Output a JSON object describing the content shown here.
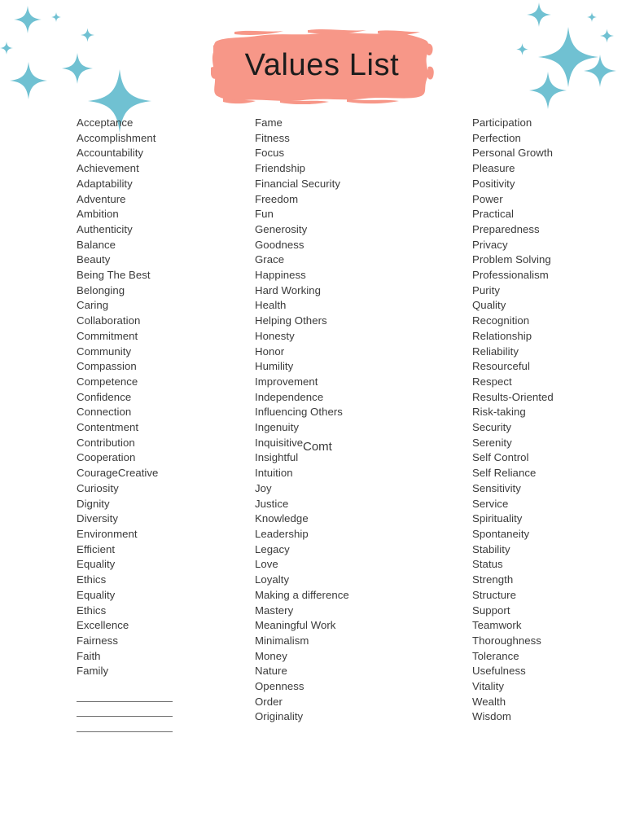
{
  "page": {
    "title": "Values List",
    "background_color": "#ffffff",
    "text_color": "#3a3a3a",
    "accent_coral": "#F79788",
    "accent_teal": "#70C1D2"
  },
  "header": {
    "title": "Values List",
    "brush_color": "#F79788",
    "sparkle_color": "#70C1D2",
    "sparkle_left_name": "sparkle-cluster-left",
    "sparkle_right_name": "sparkle-cluster-right"
  },
  "columns": [
    {
      "name": "column-1",
      "items": [
        "Acceptance",
        "Accomplishment",
        "Accountability",
        "Achievement",
        "Adaptability",
        "Adventure",
        "Ambition",
        "Authenticity",
        "Balance",
        "Beauty",
        "Being The Best",
        "Belonging",
        "Caring",
        "Collaboration",
        "Commitment",
        "Community",
        "Compassion",
        "Competence",
        "Confidence",
        "Connection",
        "Contentment",
        "Contribution",
        "Cooperation",
        "CourageCreative",
        "Curiosity",
        "Dignity",
        "Diversity",
        "Environment",
        "Efficient",
        "Equality",
        "Ethics",
        "Equality",
        "Ethics",
        "Excellence",
        "Fairness",
        "Faith",
        "Family"
      ],
      "blank_lines": 3
    },
    {
      "name": "column-2",
      "items": [
        "Fame",
        "Fitness",
        "Focus",
        "Friendship",
        "Financial Security",
        "Freedom",
        "Fun",
        "Generosity",
        "Goodness",
        "Grace",
        "Happiness",
        "Hard Working",
        "Health",
        "Helping Others",
        "Honesty",
        "Honor",
        "Humility",
        "Improvement",
        "Independence",
        "Influencing Others",
        "Ingenuity",
        "Inquisitive",
        "Insightful",
        "Intuition",
        "Joy",
        "Justice",
        "Knowledge",
        "Leadership",
        "Legacy",
        "Love",
        "Loyalty",
        "Making a difference",
        "Mastery",
        "Meaningful Work",
        "Minimalism",
        "Money",
        "Nature",
        "Openness",
        "Order",
        "Originality"
      ],
      "blank_lines": 0
    },
    {
      "name": "column-3",
      "items": [
        "Participation",
        "Perfection",
        "Personal Growth",
        "Pleasure",
        "Positivity",
        "Power",
        "Practical",
        "Preparedness",
        "Privacy",
        "Problem Solving",
        "Professionalism",
        "Purity",
        "Quality",
        "Recognition",
        "Relationship",
        "Reliability",
        "Resourceful",
        "Respect",
        "Results-Oriented",
        "Risk-taking",
        "Security",
        "Serenity",
        "Self Control",
        "Self Reliance",
        "Sensitivity",
        "Service",
        "Spirituality",
        "Spontaneity",
        "Stability",
        "Status",
        "Strength",
        "Structure",
        "Support",
        "Teamwork",
        "Thoroughness",
        "Tolerance",
        "Usefulness",
        "Vitality",
        "Wealth",
        "Wisdom"
      ],
      "blank_lines": 0
    }
  ],
  "artifacts": {
    "stray_text": "Comt"
  }
}
